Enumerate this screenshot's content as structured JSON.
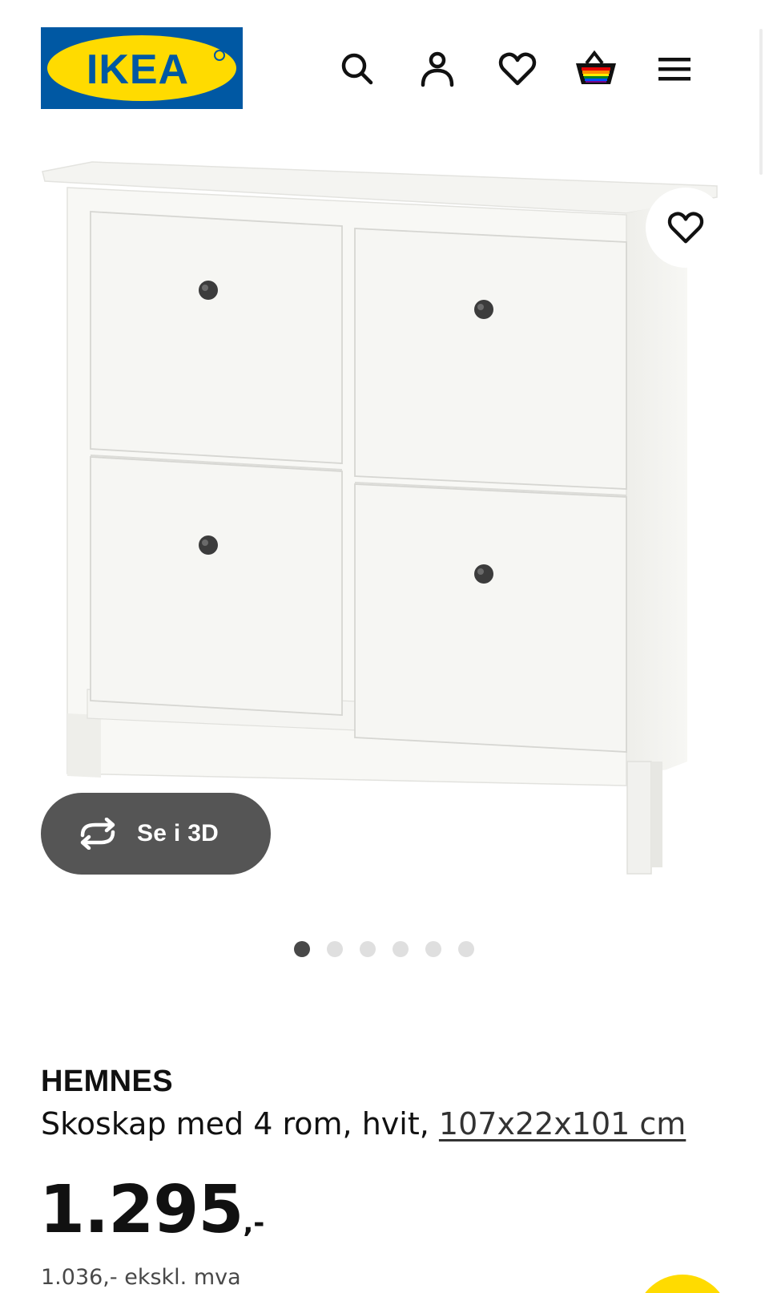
{
  "header": {
    "logo_text": "IKEA",
    "icons": [
      "search-icon",
      "account-icon",
      "heart-icon",
      "basket-icon",
      "menu-icon"
    ],
    "brand_blue": "#0058A3",
    "brand_yellow": "#FFDB00"
  },
  "gallery": {
    "view_3d_label": "Se i 3D",
    "image_count": 6,
    "active_index": 0
  },
  "product": {
    "name": "HEMNES",
    "description": "Skoskap med 4 rom, hvit,",
    "dimensions": "107x22x101 cm",
    "price_main": "1.295",
    "price_suffix": ",-",
    "price_ex_vat": "1.036,- ekskl. mva"
  }
}
